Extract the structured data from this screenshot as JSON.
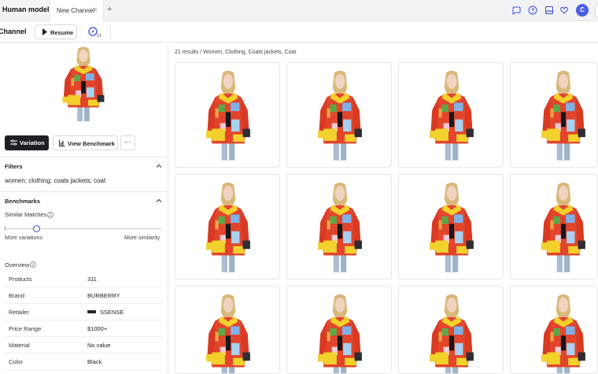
{
  "topbar": {
    "app_title": "Human model",
    "tab_label": "New Channel",
    "tab_close": "×",
    "tab_add": "+",
    "avatar_initial": "C",
    "icons": [
      "chat-icon",
      "help-icon",
      "image-icon",
      "heart-icon"
    ]
  },
  "channel": {
    "title": "Channel",
    "resume_label": "Resume",
    "compass_count": "21"
  },
  "left": {
    "variation_label": "Variation",
    "benchmark_label": "View Benchmark",
    "more_label": "···",
    "filters_title": "Filters",
    "filters_text": "women; clothing; coats jackets; coat",
    "benchmarks_title": "Benchmarks",
    "similar_matches_label": "Similar Matches",
    "slider_value": 0.2,
    "slider_left_label": "More variations",
    "slider_right_label": "More similarity",
    "overview_label": "Overview",
    "overview_rows": [
      {
        "key": "Products",
        "value": "311"
      },
      {
        "key": "Brand",
        "value": "BURBERRY"
      },
      {
        "key": "Retailer",
        "value": "SSENSE"
      },
      {
        "key": "Price Range",
        "value": "$1000+"
      },
      {
        "key": "Material",
        "value": "No value"
      },
      {
        "key": "Color",
        "value": "Black"
      }
    ]
  },
  "results": {
    "header": "21 results / Women, Clothing, Coats jackets, Coat",
    "visible_cards": 12
  },
  "colors": {
    "accent": "#3b4bd6",
    "avatar": "#4a5ee8",
    "dark_button": "#1d1f24",
    "jacket_red": "#e2452b",
    "jacket_yellow": "#f2d12c",
    "jacket_blue": "#7fb0e8"
  }
}
